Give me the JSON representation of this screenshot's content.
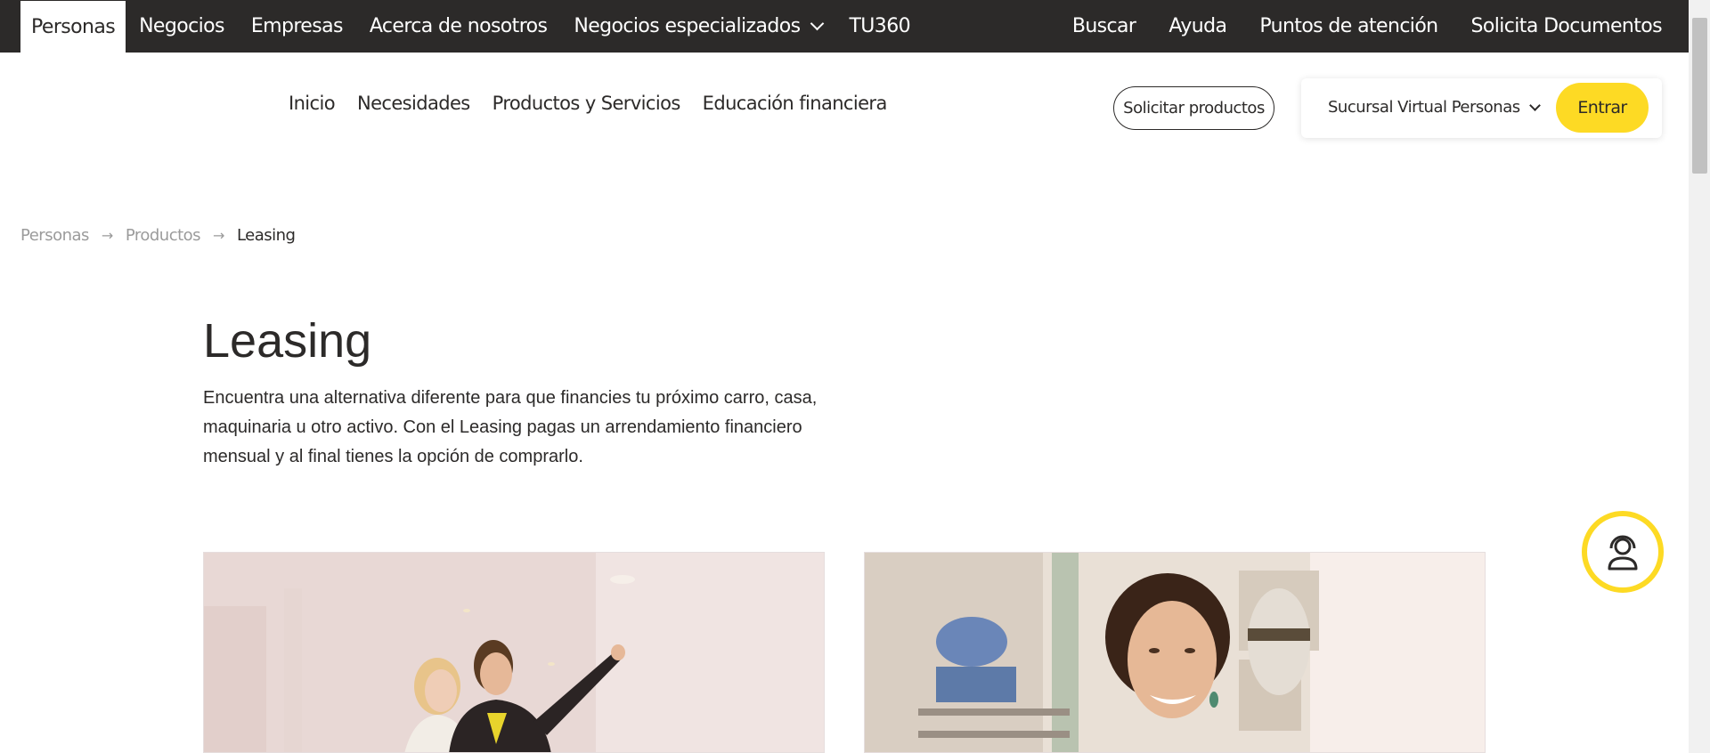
{
  "topbar": {
    "tabs": [
      "Personas",
      "Negocios",
      "Empresas",
      "Acerca de nosotros",
      "Negocios especializados",
      "TU360"
    ],
    "active_tab": "Personas",
    "links": [
      "Buscar",
      "Ayuda",
      "Puntos de atención",
      "Solicita Documentos"
    ]
  },
  "subnav": {
    "items": [
      "Inicio",
      "Necesidades",
      "Productos y Servicios",
      "Educación financiera"
    ],
    "request_button": "Solicitar productos",
    "virtual_branch": "Sucursal Virtual Personas",
    "enter_button": "Entrar"
  },
  "breadcrumb": [
    "Personas",
    "Productos",
    "Leasing"
  ],
  "page": {
    "title": "Leasing",
    "description": "Encuentra una alternativa diferente para que financies tu próximo carro, casa, maquinaria u otro activo. Con el Leasing pagas un arrendamiento financiero mensual y al final tienes la opción de comprarlo."
  },
  "colors": {
    "brand_yellow": "#fdda24",
    "dark": "#2c2a29",
    "muted": "#9b9b9b"
  },
  "icons": {
    "chat": "person-headset-icon",
    "chevron": "chevron-down-icon",
    "breadcrumb_separator": "arrow-right-icon"
  }
}
